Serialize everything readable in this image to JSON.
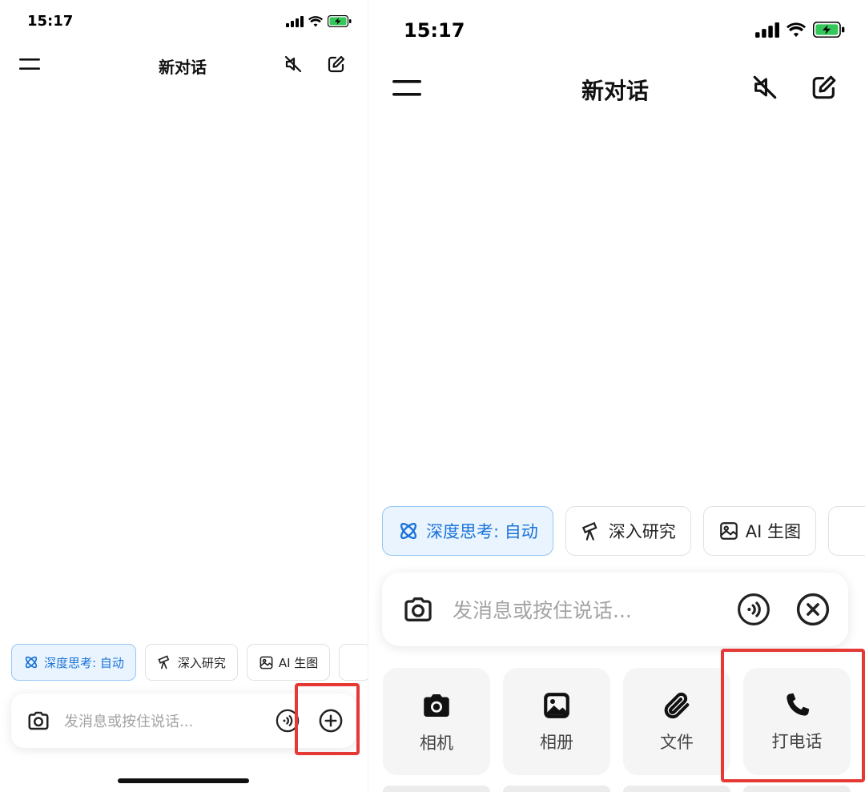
{
  "status": {
    "time": "15:17"
  },
  "nav": {
    "title": "新对话"
  },
  "chips": {
    "deep_think": "深度思考: 自动",
    "deep_research": "深入研究",
    "ai_image": "AI 生图"
  },
  "input": {
    "placeholder": "发消息或按住说话..."
  },
  "tools": [
    {
      "label": "相机"
    },
    {
      "label": "相册"
    },
    {
      "label": "文件"
    },
    {
      "label": "打电话"
    }
  ],
  "colors": {
    "accent": "#1a73d9",
    "chip_active_bg": "#eaf4fe",
    "highlight": "#e53935",
    "battery": "#34c759"
  }
}
